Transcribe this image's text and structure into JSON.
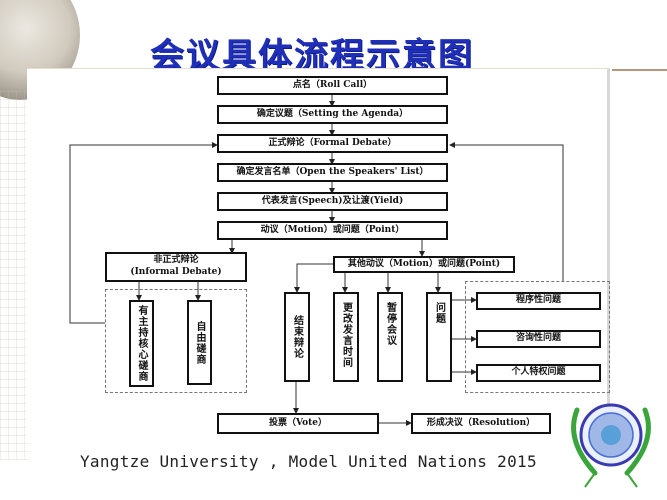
{
  "title": "会议具体流程示意图",
  "footer": "Yangtze University , Model United Nations 2015",
  "flow": {
    "roll_call": "点名（Roll Call）",
    "setting_agenda": "确定议题（Setting the Agenda）",
    "formal_debate": "正式辩论（Formal Debate）",
    "speakers_list": "确定发言名单（Open the Speakers' List）",
    "speech_yield": "代表发言(Speech)及让渡(Yield)",
    "motion_point": "动议（Motion）或问题（Point）",
    "informal_debate_cn": "非正式辩论",
    "informal_debate_en": "(Informal Debate)",
    "moderated_caucus": "有主持核心磋商",
    "unmoderated_caucus": "自由磋商",
    "other_motions": "其他动议（Motion）或问题(Point)",
    "close_debate": "结束辩论",
    "change_speaking_time": "更改发言时间",
    "suspend_meeting": "暂停会议",
    "question": "问题",
    "point_of_order": "程序性问题",
    "point_of_inquiry": "咨询性问题",
    "point_of_personal_privilege": "个人特权问题",
    "vote": "投票（Vote）",
    "resolution": "形成决议（Resolution）"
  },
  "colors": {
    "title": "#1f2fb8",
    "box_border": "#111111",
    "emblem_blue": "#3a3ab0",
    "emblem_green": "#3aa53a"
  }
}
